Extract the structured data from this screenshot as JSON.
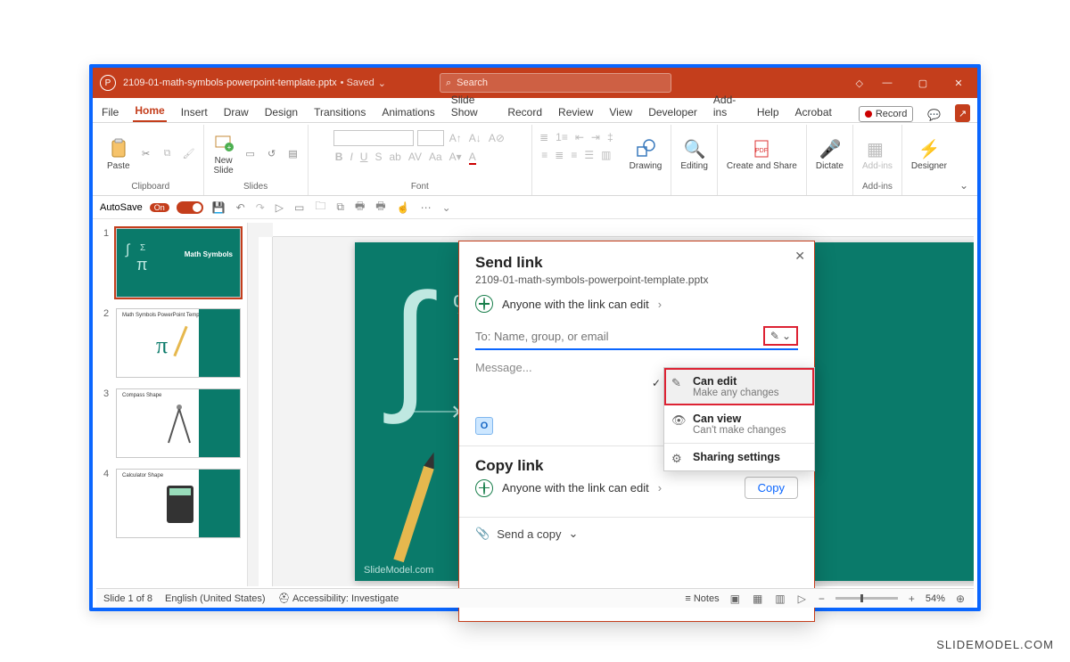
{
  "titlebar": {
    "filename": "2109-01-math-symbols-powerpoint-template.pptx",
    "saved_label": "• Saved",
    "chevron": "⌄",
    "search_placeholder": "Search",
    "minimize": "—",
    "restore": "▢",
    "close": "✕"
  },
  "tabs": {
    "file": "File",
    "home": "Home",
    "insert": "Insert",
    "draw": "Draw",
    "design": "Design",
    "transitions": "Transitions",
    "animations": "Animations",
    "slideshow": "Slide Show",
    "record": "Record",
    "review": "Review",
    "view": "View",
    "developer": "Developer",
    "addins": "Add-ins",
    "help": "Help",
    "acrobat": "Acrobat",
    "record_btn": "Record"
  },
  "ribbon": {
    "clipboard": {
      "paste": "Paste",
      "label": "Clipboard"
    },
    "slides": {
      "newslide": "New\nSlide",
      "label": "Slides"
    },
    "font": {
      "label": "Font"
    },
    "drawing": {
      "label": "Drawing"
    },
    "editing": {
      "label": "Editing"
    },
    "createshare": {
      "label": "Create and Share"
    },
    "voice": {
      "dictate": "Dictate"
    },
    "addins_group": {
      "addins": "Add-ins",
      "label": "Add-ins"
    },
    "designer": {
      "label": "Designer"
    }
  },
  "qat": {
    "autosave": "AutoSave",
    "on": "On"
  },
  "thumbs": {
    "n1": "1",
    "t1": "Math Symbols",
    "n2": "2",
    "t2": "Math Symbols PowerPoint Template",
    "n3": "3",
    "t3": "Compass Shape",
    "n4": "4",
    "t4": "Calculator Shape"
  },
  "slide": {
    "watermark": "SlideModel.com"
  },
  "dialog": {
    "title": "Send link",
    "file": "2109-01-math-symbols-powerpoint-template.pptx",
    "anyone_edit": "Anyone with the link can edit",
    "to_placeholder": "To: Name, group, or email",
    "message": "Message...",
    "copy_title": "Copy link",
    "anyone_edit2": "Anyone with the link can edit",
    "copy_btn": "Copy",
    "send_copy": "Send a copy"
  },
  "perm_menu": {
    "can_edit": "Can edit",
    "can_edit_sub": "Make any changes",
    "can_view": "Can view",
    "can_view_sub": "Can't make changes",
    "settings": "Sharing settings"
  },
  "status": {
    "slide_of": "Slide 1 of 8",
    "lang": "English (United States)",
    "access": "Accessibility: Investigate",
    "notes": "Notes",
    "zoom": "54%"
  },
  "watermark_ext": "SLIDEMODEL.COM"
}
